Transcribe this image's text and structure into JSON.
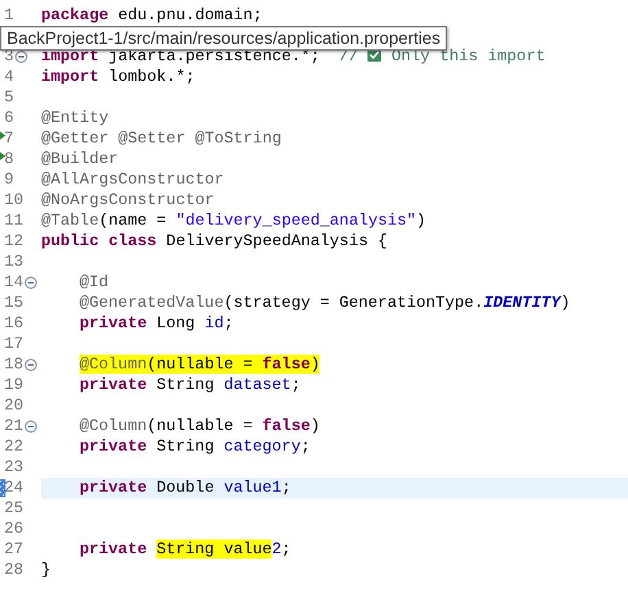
{
  "editor": {
    "lines": [
      {
        "number": "1",
        "kind": "plain",
        "fold": false,
        "current": false,
        "indent": false,
        "tokens": [
          {
            "text": "package",
            "kind": "keyword",
            "highlight": false
          },
          {
            "text": " edu.pnu.domain;",
            "kind": "plain",
            "highlight": false
          }
        ]
      },
      {
        "number": "3",
        "kind": "plain",
        "fold": true,
        "current": false,
        "indent": false,
        "tokens": [
          {
            "text": "import",
            "kind": "keyword",
            "highlight": false
          },
          {
            "text": " jakarta.persistence.*;  ",
            "kind": "plain",
            "highlight": false
          },
          {
            "text": "// ",
            "kind": "comment",
            "highlight": false
          },
          {
            "kind": "check-icon"
          },
          {
            "text": " Only this import",
            "kind": "comment",
            "highlight": false
          }
        ]
      },
      {
        "number": "4",
        "kind": "plain",
        "fold": false,
        "current": false,
        "indent": false,
        "tokens": [
          {
            "text": "import",
            "kind": "keyword",
            "highlight": false
          },
          {
            "text": " lombok.*;",
            "kind": "plain",
            "highlight": false
          }
        ]
      },
      {
        "number": "5",
        "kind": "plain",
        "fold": false,
        "current": false
      },
      {
        "number": "6",
        "kind": "plain",
        "fold": false,
        "current": false,
        "indent": false,
        "tokens": [
          {
            "text": "@Entity",
            "kind": "annotation",
            "highlight": false
          }
        ]
      },
      {
        "number": "7",
        "kind": "override",
        "fold": false,
        "current": false,
        "indent": false,
        "tokens": [
          {
            "text": "@Getter @Setter @ToString",
            "kind": "annotation",
            "highlight": false
          }
        ]
      },
      {
        "number": "8",
        "kind": "override",
        "fold": false,
        "current": false,
        "indent": false,
        "tokens": [
          {
            "text": "@Builder",
            "kind": "annotation",
            "highlight": false
          }
        ]
      },
      {
        "number": "9",
        "kind": "plain",
        "fold": false,
        "current": false,
        "indent": false,
        "tokens": [
          {
            "text": "@AllArgsConstructor",
            "kind": "annotation",
            "highlight": false
          }
        ]
      },
      {
        "number": "10",
        "kind": "plain",
        "fold": false,
        "current": false,
        "indent": false,
        "tokens": [
          {
            "text": "@NoArgsConstructor",
            "kind": "annotation",
            "highlight": false
          }
        ]
      },
      {
        "number": "11",
        "kind": "plain",
        "fold": false,
        "current": false,
        "indent": false,
        "tokens": [
          {
            "text": "@Table",
            "kind": "annotation",
            "highlight": false
          },
          {
            "text": "(name = ",
            "kind": "plain",
            "highlight": false
          },
          {
            "text": "\"delivery_speed_analysis\"",
            "kind": "string",
            "highlight": false
          },
          {
            "text": ")",
            "kind": "plain",
            "highlight": false
          }
        ]
      },
      {
        "number": "12",
        "kind": "plain",
        "fold": false,
        "current": false,
        "indent": false,
        "tokens": [
          {
            "text": "public class",
            "kind": "keyword",
            "highlight": false
          },
          {
            "text": " DeliverySpeedAnalysis {",
            "kind": "plain",
            "highlight": false
          }
        ]
      },
      {
        "number": "13",
        "kind": "plain",
        "fold": false,
        "current": false
      },
      {
        "number": "14",
        "kind": "plain",
        "fold": true,
        "current": false,
        "indent": true,
        "tokens": [
          {
            "text": "@Id",
            "kind": "annotation",
            "highlight": false
          }
        ]
      },
      {
        "number": "15",
        "kind": "plain",
        "fold": false,
        "current": false,
        "indent": true,
        "tokens": [
          {
            "text": "@GeneratedValue",
            "kind": "annotation",
            "highlight": false
          },
          {
            "text": "(strategy = GenerationType.",
            "kind": "plain",
            "highlight": false
          },
          {
            "text": "IDENTITY",
            "kind": "static",
            "highlight": false
          },
          {
            "text": ")",
            "kind": "plain",
            "highlight": false
          }
        ]
      },
      {
        "number": "16",
        "kind": "plain",
        "fold": false,
        "current": false,
        "indent": true,
        "tokens": [
          {
            "text": "private",
            "kind": "keyword",
            "highlight": false
          },
          {
            "text": " Long ",
            "kind": "plain",
            "highlight": false
          },
          {
            "text": "id",
            "kind": "field",
            "highlight": false
          },
          {
            "text": ";",
            "kind": "plain",
            "highlight": false
          }
        ]
      },
      {
        "number": "17",
        "kind": "plain",
        "fold": false,
        "current": false
      },
      {
        "number": "18",
        "kind": "plain",
        "fold": true,
        "current": false,
        "indent": true,
        "tokens": [
          {
            "text": "@Column",
            "kind": "annotation",
            "highlight": true
          },
          {
            "text": "(nullable = ",
            "kind": "plain",
            "highlight": true
          },
          {
            "text": "false",
            "kind": "keyword",
            "highlight": true
          },
          {
            "text": ")",
            "kind": "plain",
            "highlight": true
          }
        ]
      },
      {
        "number": "19",
        "kind": "plain",
        "fold": false,
        "current": false,
        "indent": true,
        "tokens": [
          {
            "text": "private",
            "kind": "keyword",
            "highlight": false
          },
          {
            "text": " String ",
            "kind": "plain",
            "highlight": false
          },
          {
            "text": "dataset",
            "kind": "field",
            "highlight": false
          },
          {
            "text": ";",
            "kind": "plain",
            "highlight": false
          }
        ]
      },
      {
        "number": "20",
        "kind": "plain",
        "fold": false,
        "current": false
      },
      {
        "number": "21",
        "kind": "plain",
        "fold": true,
        "current": false,
        "indent": true,
        "tokens": [
          {
            "text": "@Column",
            "kind": "annotation",
            "highlight": false
          },
          {
            "text": "(nullable = ",
            "kind": "plain",
            "highlight": false
          },
          {
            "text": "false",
            "kind": "keyword",
            "highlight": false
          },
          {
            "text": ")",
            "kind": "plain",
            "highlight": false
          }
        ]
      },
      {
        "number": "22",
        "kind": "plain",
        "fold": false,
        "current": false,
        "indent": true,
        "tokens": [
          {
            "text": "private",
            "kind": "keyword",
            "highlight": false
          },
          {
            "text": " String ",
            "kind": "plain",
            "highlight": false
          },
          {
            "text": "category",
            "kind": "field",
            "highlight": false
          },
          {
            "text": ";",
            "kind": "plain",
            "highlight": false
          }
        ]
      },
      {
        "number": "23",
        "kind": "plain",
        "fold": false,
        "current": false
      },
      {
        "number": "24",
        "kind": "change",
        "fold": false,
        "current": true,
        "indent": true,
        "tokens": [
          {
            "text": "private",
            "kind": "keyword",
            "highlight": false
          },
          {
            "text": " Double ",
            "kind": "plain",
            "highlight": false
          },
          {
            "text": "value1",
            "kind": "field",
            "highlight": false
          },
          {
            "text": ";",
            "kind": "plain",
            "highlight": false
          }
        ]
      },
      {
        "number": "25",
        "kind": "plain",
        "fold": false,
        "current": false
      },
      {
        "number": "26",
        "kind": "plain",
        "fold": false,
        "current": false
      },
      {
        "number": "27",
        "kind": "plain",
        "fold": false,
        "current": false,
        "indent": true,
        "tokens": [
          {
            "text": "private ",
            "kind": "keyword",
            "highlight": false
          },
          {
            "text": "String value",
            "kind": "plain",
            "highlight": true
          },
          {
            "text": "2",
            "kind": "field",
            "highlight": false
          },
          {
            "text": ";",
            "kind": "plain",
            "highlight": false
          }
        ]
      },
      {
        "number": "28",
        "kind": "plain",
        "fold": false,
        "current": false,
        "indent": false,
        "tokens": [
          {
            "text": "}",
            "kind": "plain",
            "highlight": false
          }
        ]
      }
    ]
  },
  "tooltip": {
    "text": "BackProject1-1/src/main/resources/application.properties"
  }
}
